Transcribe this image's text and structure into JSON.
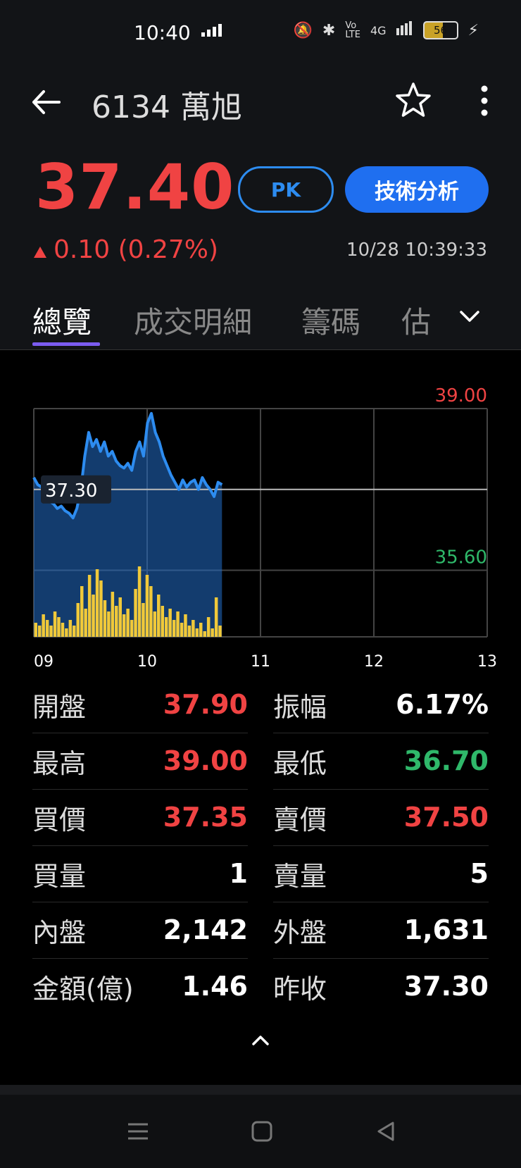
{
  "status_bar": {
    "time": "10:40",
    "network": "4G",
    "battery": "56"
  },
  "header": {
    "title": "6134 萬旭",
    "price": "37.40",
    "change": "0.10 (0.27%)",
    "timestamp": "10/28 10:39:33",
    "pk_label": "PK",
    "technical_label": "技術分析"
  },
  "tabs": [
    "總覽",
    "成交明細",
    "籌碼",
    "估"
  ],
  "chart_data": {
    "type": "line",
    "y_upper_label": "39.00",
    "y_lower_label": "35.60",
    "ref_price_label": "37.30",
    "y_axis_range": [
      34.2,
      39.0
    ],
    "ref_price": 37.3,
    "x_ticks": [
      "09",
      "10",
      "11",
      "12",
      "13"
    ],
    "price_series": [
      37.55,
      37.4,
      37.35,
      37.2,
      37.05,
      37.0,
      36.9,
      36.95,
      36.85,
      36.8,
      36.7,
      36.9,
      37.3,
      38.0,
      38.5,
      38.2,
      38.35,
      38.1,
      38.3,
      38.0,
      38.1,
      37.9,
      37.8,
      37.75,
      37.85,
      37.7,
      38.1,
      38.3,
      38.0,
      38.7,
      38.9,
      38.5,
      38.3,
      38.0,
      37.8,
      37.6,
      37.45,
      37.3,
      37.5,
      37.35,
      37.45,
      37.5,
      37.3,
      37.55,
      37.4,
      37.3,
      37.15,
      37.45,
      37.4
    ],
    "volume_series": [
      5,
      4,
      8,
      6,
      4,
      9,
      7,
      5,
      3,
      6,
      4,
      12,
      18,
      10,
      22,
      15,
      24,
      20,
      13,
      9,
      16,
      11,
      14,
      8,
      10,
      6,
      17,
      25,
      12,
      22,
      18,
      9,
      15,
      11,
      7,
      10,
      6,
      9,
      5,
      8,
      4,
      6,
      3,
      5,
      2,
      7,
      3,
      14,
      4
    ]
  },
  "stats": {
    "left": [
      {
        "label": "開盤",
        "value": "37.90",
        "color": "red"
      },
      {
        "label": "最高",
        "value": "39.00",
        "color": "red"
      },
      {
        "label": "買價",
        "value": "37.35",
        "color": "red"
      },
      {
        "label": "買量",
        "value": "1",
        "color": "white"
      },
      {
        "label": "內盤",
        "value": "2,142",
        "color": "white"
      },
      {
        "label": "金額(億)",
        "value": "1.46",
        "color": "white"
      }
    ],
    "right": [
      {
        "label": "振幅",
        "value": "6.17%",
        "color": "white"
      },
      {
        "label": "最低",
        "value": "36.70",
        "color": "green"
      },
      {
        "label": "賣價",
        "value": "37.50",
        "color": "red"
      },
      {
        "label": "賣量",
        "value": "5",
        "color": "white"
      },
      {
        "label": "外盤",
        "value": "1,631",
        "color": "white"
      },
      {
        "label": "昨收",
        "value": "37.30",
        "color": "white"
      }
    ]
  },
  "colors": {
    "up": "#f04343",
    "down": "#2fb86a",
    "accent": "#1f6ff0",
    "line": "#2d8cf0",
    "volume": "#f0c93a"
  }
}
